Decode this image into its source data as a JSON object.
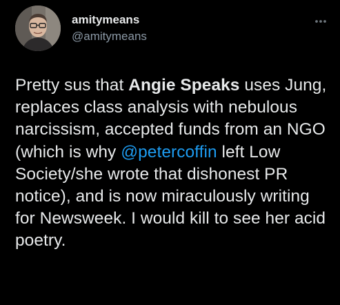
{
  "tweet": {
    "author": {
      "display_name": "amitymeans",
      "handle": "@amitymeans"
    },
    "more_icon": "more-horizontal-icon",
    "body": {
      "part1": "Pretty sus that ",
      "bold": "Angie Speaks",
      "part2": " uses Jung, replaces class analysis with nebulous narcissism, accepted funds from an NGO (which is why ",
      "mention": "@petercoffin",
      "part3": " left Low Society/she wrote that dishonest PR notice), and is now miraculously writing for Newsweek. I would kill to see her acid poetry."
    }
  },
  "colors": {
    "background": "#000000",
    "text": "#e7e9ea",
    "secondary": "#8b98a5",
    "mention": "#1d9bf0"
  }
}
